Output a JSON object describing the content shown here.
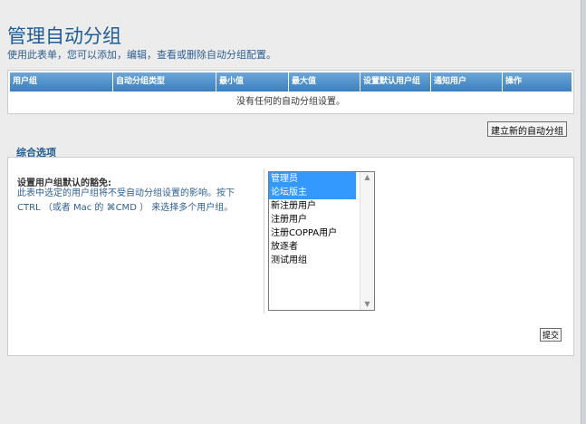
{
  "page": {
    "title": "管理自动分组",
    "description": "使用此表单，您可以添加，编辑，查看或删除自动分组配置。"
  },
  "table": {
    "columns": [
      {
        "label": "用户组",
        "width": 114
      },
      {
        "label": "自动分组类型",
        "width": 114
      },
      {
        "label": "最小值",
        "width": 80
      },
      {
        "label": "最大值",
        "width": 79
      },
      {
        "label": "设置默认用户组",
        "width": 78
      },
      {
        "label": "通知用户",
        "width": 79
      },
      {
        "label": "操作",
        "width": 76
      }
    ],
    "empty_message": "没有任何的自动分组设置。"
  },
  "create_button_label": "建立新的自动分组",
  "options_section": {
    "title": "综合选项",
    "setting_label": "设置用户组默认的豁免:",
    "setting_description": "此表中选定的用户组将不受自动分组设置的影响。按下 CTRL （或者 Mac 的 ⌘CMD ） 来选择多个用户组。",
    "groups": [
      {
        "label": "管理员",
        "selected": true
      },
      {
        "label": "论坛版主",
        "selected": true
      },
      {
        "label": "新注册用户",
        "selected": false
      },
      {
        "label": "注册用户",
        "selected": false
      },
      {
        "label": "注册COPPA用户",
        "selected": false
      },
      {
        "label": "放逐者",
        "selected": false
      },
      {
        "label": "测试用组",
        "selected": false
      }
    ]
  },
  "submit_button_label": "提交",
  "colors": {
    "header_bar": "#3a7fbe",
    "title": "#1f5b96",
    "selected_option": "#3399ff"
  }
}
